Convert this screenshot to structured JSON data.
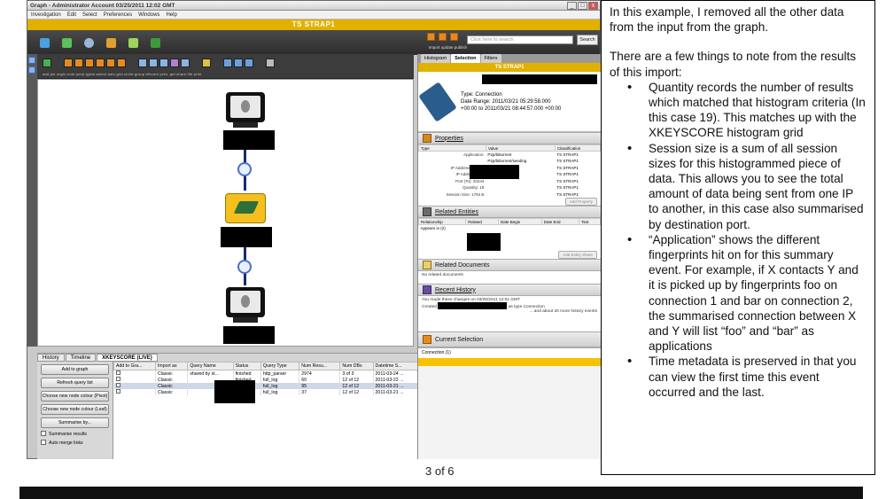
{
  "window": {
    "title": "Graph - Administrator Account 03/25/2011 12:02 GMT",
    "controls": [
      "_",
      "□",
      "x"
    ]
  },
  "menu": [
    "Investigation",
    "Edit",
    "Select",
    "Preferences",
    "Windows",
    "Help"
  ],
  "classification": "TS STRAP1",
  "search": {
    "placeholder": "Click here to search",
    "button": "Search"
  },
  "toolbar_right_labels": "Import update publish",
  "graph_toolbar_labels": "add  pin  unpin  note  jump  types  select   auto  grid  circle  group  ethcore   pres.   get  share  file   print",
  "bottom_tabs": [
    "History",
    "Timeline",
    "XKEYSCORE (LIVE)"
  ],
  "bottom_buttons": [
    "Add to graph",
    "Refresh query list",
    "Choose new node colour (Pivot)",
    "Choose new node colour (Leaf)",
    "Summarise by..."
  ],
  "bottom_checks": [
    "Summarise results",
    "Auto merge links"
  ],
  "query_table": {
    "headers": [
      "Add to Gra...",
      "Import as",
      "Query Name",
      "Status",
      "Query Type",
      "Num Resu...",
      "Num DBs",
      "Datetime S..."
    ],
    "rows": [
      [
        "",
        "Classic",
        "shared by st...",
        "finished",
        "http_parser",
        "2974",
        "3 of 3",
        "2011-03-24 ..."
      ],
      [
        "",
        "Classic",
        "",
        "finished",
        "full_log",
        "60",
        "12 of 12",
        "2011-03-22 ..."
      ],
      [
        "",
        "Classic",
        "",
        "finished",
        "full_log",
        "95",
        "12 of 12",
        "2011-03-21 ..."
      ],
      [
        "",
        "Classic",
        "",
        "finished",
        "full_log",
        "37",
        "12 of 12",
        "2011-03-21 ..."
      ]
    ]
  },
  "right_panel": {
    "tabs": [
      "Histogram",
      "Selection",
      "Filters"
    ],
    "classification": "TS STRAP1",
    "type_line": "Type: Connection",
    "date_line1": "Date Range: 2011/03/21 05:29:58.000",
    "date_line2": "+00:00 to 2011/03/21 08:44:57.000 +00:00",
    "properties_title": "Properties",
    "prop_headers": [
      "Type",
      "Value",
      "Classification"
    ],
    "props": [
      [
        "Application:",
        "P2p/bittorrent",
        "TS STRAP1"
      ],
      [
        "",
        "P2p/bittorrent/seeding",
        "TS STRAP1"
      ],
      [
        "IP Address (From):",
        "",
        "TS STRAP1"
      ],
      [
        "IP Address (To):",
        "",
        "TS STRAP1"
      ],
      [
        "Port (To): 20444",
        "",
        "TS STRAP1"
      ],
      [
        "Quantity: 19",
        "",
        "TS STRAP1"
      ],
      [
        "Session Size: 1794 B",
        "",
        "TS STRAP1"
      ]
    ],
    "add_property": "Add Property",
    "related_entities_title": "Related Entities",
    "rel_headers": [
      "Relationship",
      "Related",
      "Date Begin",
      "Date End",
      "Text"
    ],
    "appears_in": "Appears in (2)",
    "add_link": "Add Entity Share",
    "related_docs_title": "Related Documents",
    "no_docs": "No related documents",
    "recent_history_title": "Recent History",
    "history_line1": "You made these changes on 03/25/2011 12:01 GMT",
    "history_line2": "Created",
    "history_line2b": "as type Connection",
    "history_more": "... and about 20 more history events",
    "current_selection_title": "Current Selection",
    "current_selection_item": "Connection (1)"
  },
  "page_number": "3 of 6",
  "note": {
    "intro": "In this example, I removed all the other data from the input from the graph.",
    "lead": "There are a few things to note from the results of this import:",
    "bullets": [
      "Quantity records the number of results which matched that histogram criteria (In this case 19). This matches up with the XKEYSCORE histogram grid",
      "Session size is a sum of all session sizes for this histogrammed piece of data. This allows you to see the total amount of data being sent from one IP to another, in this case also summarised by destination port.",
      "“Application” shows the different fingerprints hit on for this summary event. For example, if X contacts Y and it is picked up by fingerprints foo on connection 1 and bar on connection 2, the summarised connection between X and Y will list “foo” and “bar” as applications",
      "Time metadata is preserved in that you can view the first time this event occurred and the last."
    ]
  }
}
